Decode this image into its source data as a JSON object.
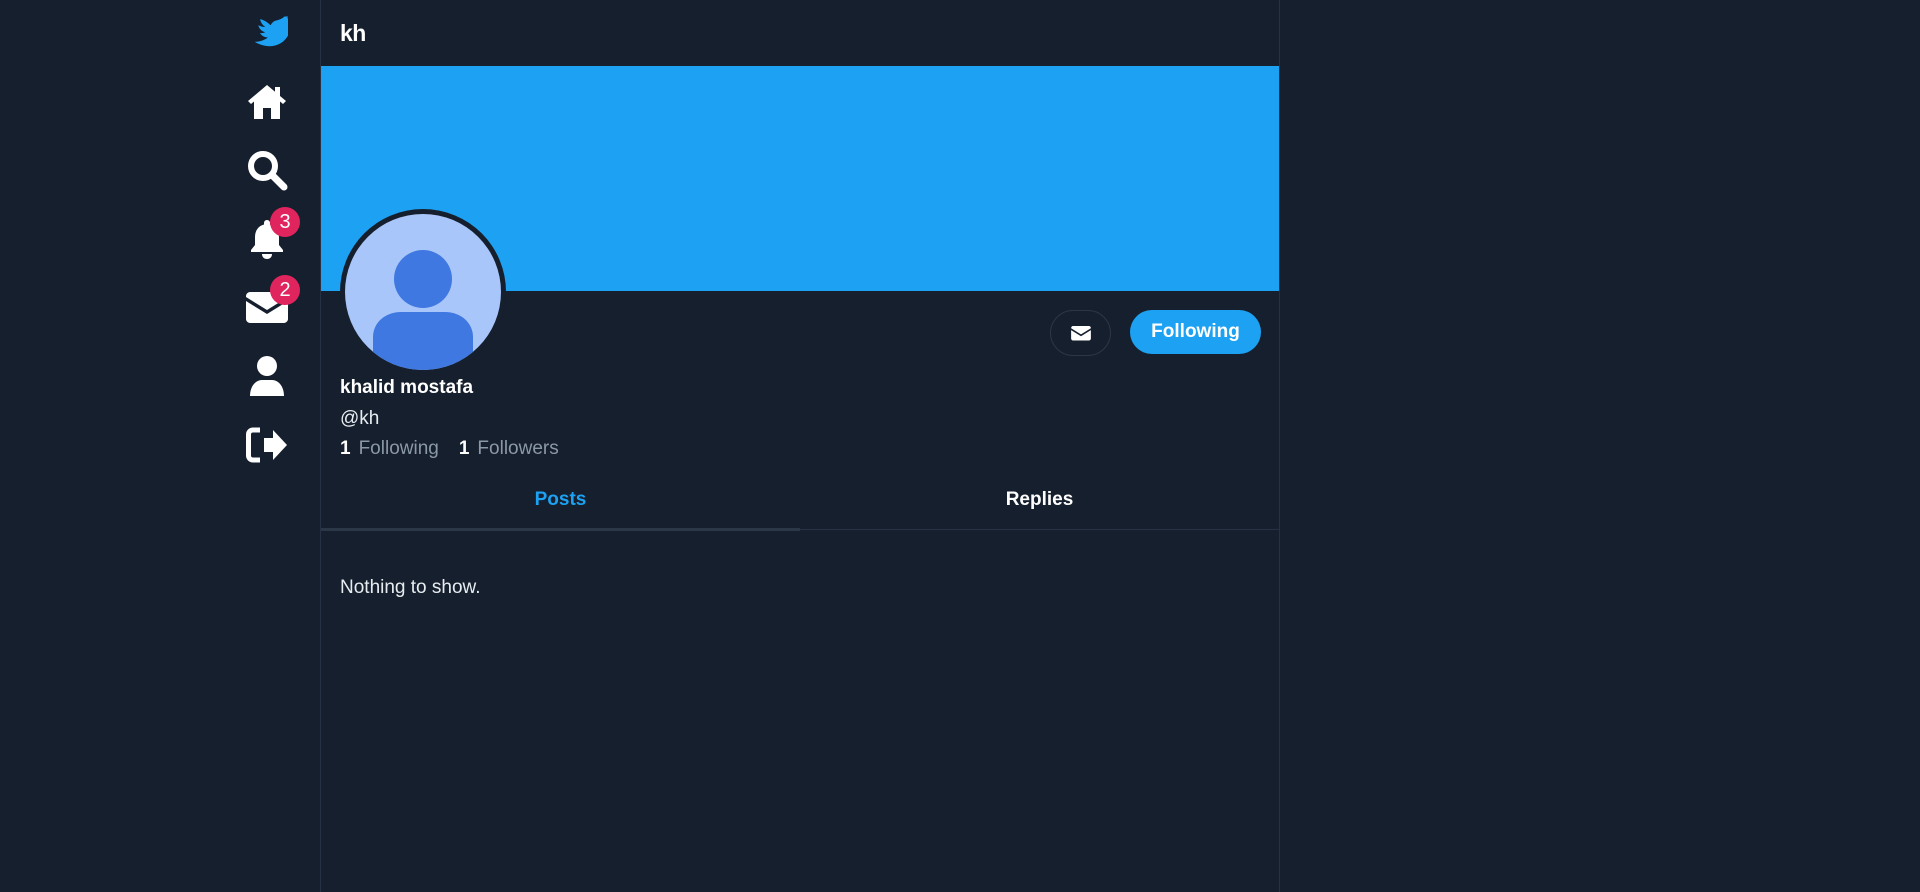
{
  "header": {
    "title": "kh"
  },
  "sidebar": {
    "items": [
      {
        "name": "logo",
        "icon": "bird-logo-icon"
      },
      {
        "name": "home",
        "icon": "home-icon"
      },
      {
        "name": "explore",
        "icon": "search-icon"
      },
      {
        "name": "notifications",
        "icon": "bell-icon",
        "badge": "3"
      },
      {
        "name": "messages",
        "icon": "envelope-icon",
        "badge": "2"
      },
      {
        "name": "profile",
        "icon": "user-icon"
      },
      {
        "name": "logout",
        "icon": "sign-out-icon"
      }
    ]
  },
  "profile": {
    "display_name": "khalid mostafa",
    "handle": "@kh",
    "following_count": "1",
    "following_label": "Following",
    "followers_count": "1",
    "followers_label": "Followers",
    "follow_button_label": "Following",
    "message_button_icon": "envelope-icon"
  },
  "tabs": [
    {
      "label": "Posts",
      "active": true
    },
    {
      "label": "Replies",
      "active": false
    }
  ],
  "feed": {
    "empty_text": "Nothing to show."
  },
  "colors": {
    "background": "#161f2d",
    "accent": "#1da1f2",
    "badge": "#e0245e",
    "avatar_bg": "#a9c6fa",
    "avatar_fg": "#3f78e0",
    "muted_text": "#8b98a5"
  }
}
